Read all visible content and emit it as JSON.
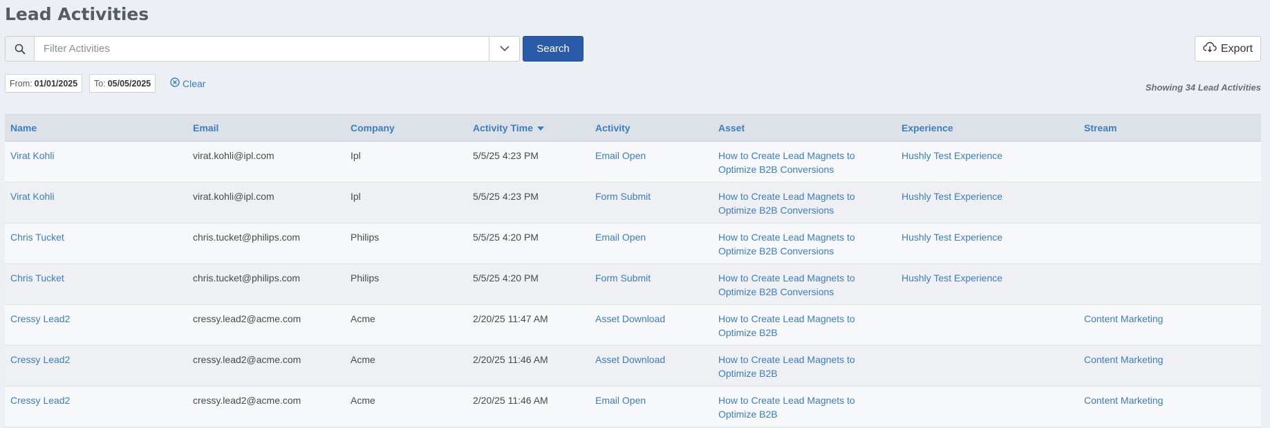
{
  "page": {
    "title": "Lead Activities"
  },
  "search": {
    "placeholder": "Filter Activities",
    "button_label": "Search"
  },
  "export": {
    "label": "Export"
  },
  "filters": {
    "from_label": "From:",
    "from_value": "01/01/2025",
    "to_label": "To:",
    "to_value": "05/05/2025",
    "clear_label": "Clear"
  },
  "summary": {
    "showing": "Showing 34 Lead Activities"
  },
  "colors": {
    "accent": "#2b5aa8",
    "link": "#3d7dbd"
  },
  "table": {
    "headers": [
      "Name",
      "Email",
      "Company",
      "Activity Time",
      "Activity",
      "Asset",
      "Experience",
      "Stream"
    ],
    "rows": [
      {
        "name": "Virat Kohli",
        "email": "virat.kohli@ipl.com",
        "company": "Ipl",
        "time": "5/5/25 4:23 PM",
        "activity": "Email Open",
        "asset_l1": "How to Create Lead Magnets to",
        "asset_l2": "Optimize B2B Conversions",
        "experience": "Hushly Test Experience",
        "stream": ""
      },
      {
        "name": "Virat Kohli",
        "email": "virat.kohli@ipl.com",
        "company": "Ipl",
        "time": "5/5/25 4:23 PM",
        "activity": "Form Submit",
        "asset_l1": "How to Create Lead Magnets to",
        "asset_l2": "Optimize B2B Conversions",
        "experience": "Hushly Test Experience",
        "stream": ""
      },
      {
        "name": "Chris Tucket",
        "email": "chris.tucket@philips.com",
        "company": "Philips",
        "time": "5/5/25 4:20 PM",
        "activity": "Email Open",
        "asset_l1": "How to Create Lead Magnets to",
        "asset_l2": "Optimize B2B Conversions",
        "experience": "Hushly Test Experience",
        "stream": ""
      },
      {
        "name": "Chris Tucket",
        "email": "chris.tucket@philips.com",
        "company": "Philips",
        "time": "5/5/25 4:20 PM",
        "activity": "Form Submit",
        "asset_l1": "How to Create Lead Magnets to",
        "asset_l2": "Optimize B2B Conversions",
        "experience": "Hushly Test Experience",
        "stream": ""
      },
      {
        "name": "Cressy Lead2",
        "email": "cressy.lead2@acme.com",
        "company": "Acme",
        "time": "2/20/25 11:47 AM",
        "activity": "Asset Download",
        "asset_l1": "How to Create Lead Magnets to",
        "asset_l2": "Optimize B2B",
        "experience": "",
        "stream": "Content Marketing"
      },
      {
        "name": "Cressy Lead2",
        "email": "cressy.lead2@acme.com",
        "company": "Acme",
        "time": "2/20/25 11:46 AM",
        "activity": "Asset Download",
        "asset_l1": "How to Create Lead Magnets to",
        "asset_l2": "Optimize B2B",
        "experience": "",
        "stream": "Content Marketing"
      },
      {
        "name": "Cressy Lead2",
        "email": "cressy.lead2@acme.com",
        "company": "Acme",
        "time": "2/20/25 11:46 AM",
        "activity": "Email Open",
        "asset_l1": "How to Create Lead Magnets to",
        "asset_l2": "Optimize B2B",
        "experience": "",
        "stream": "Content Marketing"
      }
    ]
  }
}
